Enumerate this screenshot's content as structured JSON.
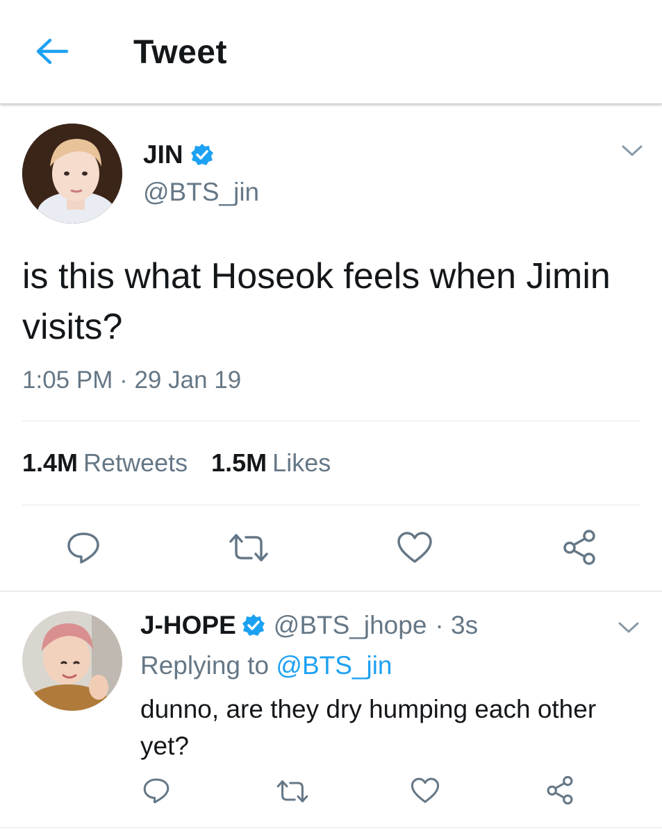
{
  "header": {
    "title": "Tweet",
    "back_icon": "arrow-left-icon",
    "accent_color": "#1da1f2"
  },
  "main_tweet": {
    "author_name": "JIN",
    "handle": "@BTS_jin",
    "verified": true,
    "text": "is this what Hoseok feels when Jimin visits?",
    "time": "1:05 PM · 29 Jan 19",
    "retweets_count": "1.4M",
    "retweets_label": "Retweets",
    "likes_count": "1.5M",
    "likes_label": "Likes",
    "actions": [
      "reply-icon",
      "retweet-icon",
      "like-icon",
      "share-icon"
    ]
  },
  "reply": {
    "author_name": "J-HOPE",
    "handle": "@BTS_jhope",
    "time": "· 3s",
    "verified": true,
    "replying_prefix": "Replying to",
    "replying_to": "@BTS_jin",
    "text": "dunno, are they dry humping each other yet?",
    "actions": [
      "reply-icon",
      "retweet-icon",
      "like-icon",
      "share-icon"
    ]
  },
  "colors": {
    "text_primary": "#14171a",
    "text_secondary": "#657786",
    "verified_blue": "#1da1f2",
    "divider": "#e1e8ed"
  }
}
